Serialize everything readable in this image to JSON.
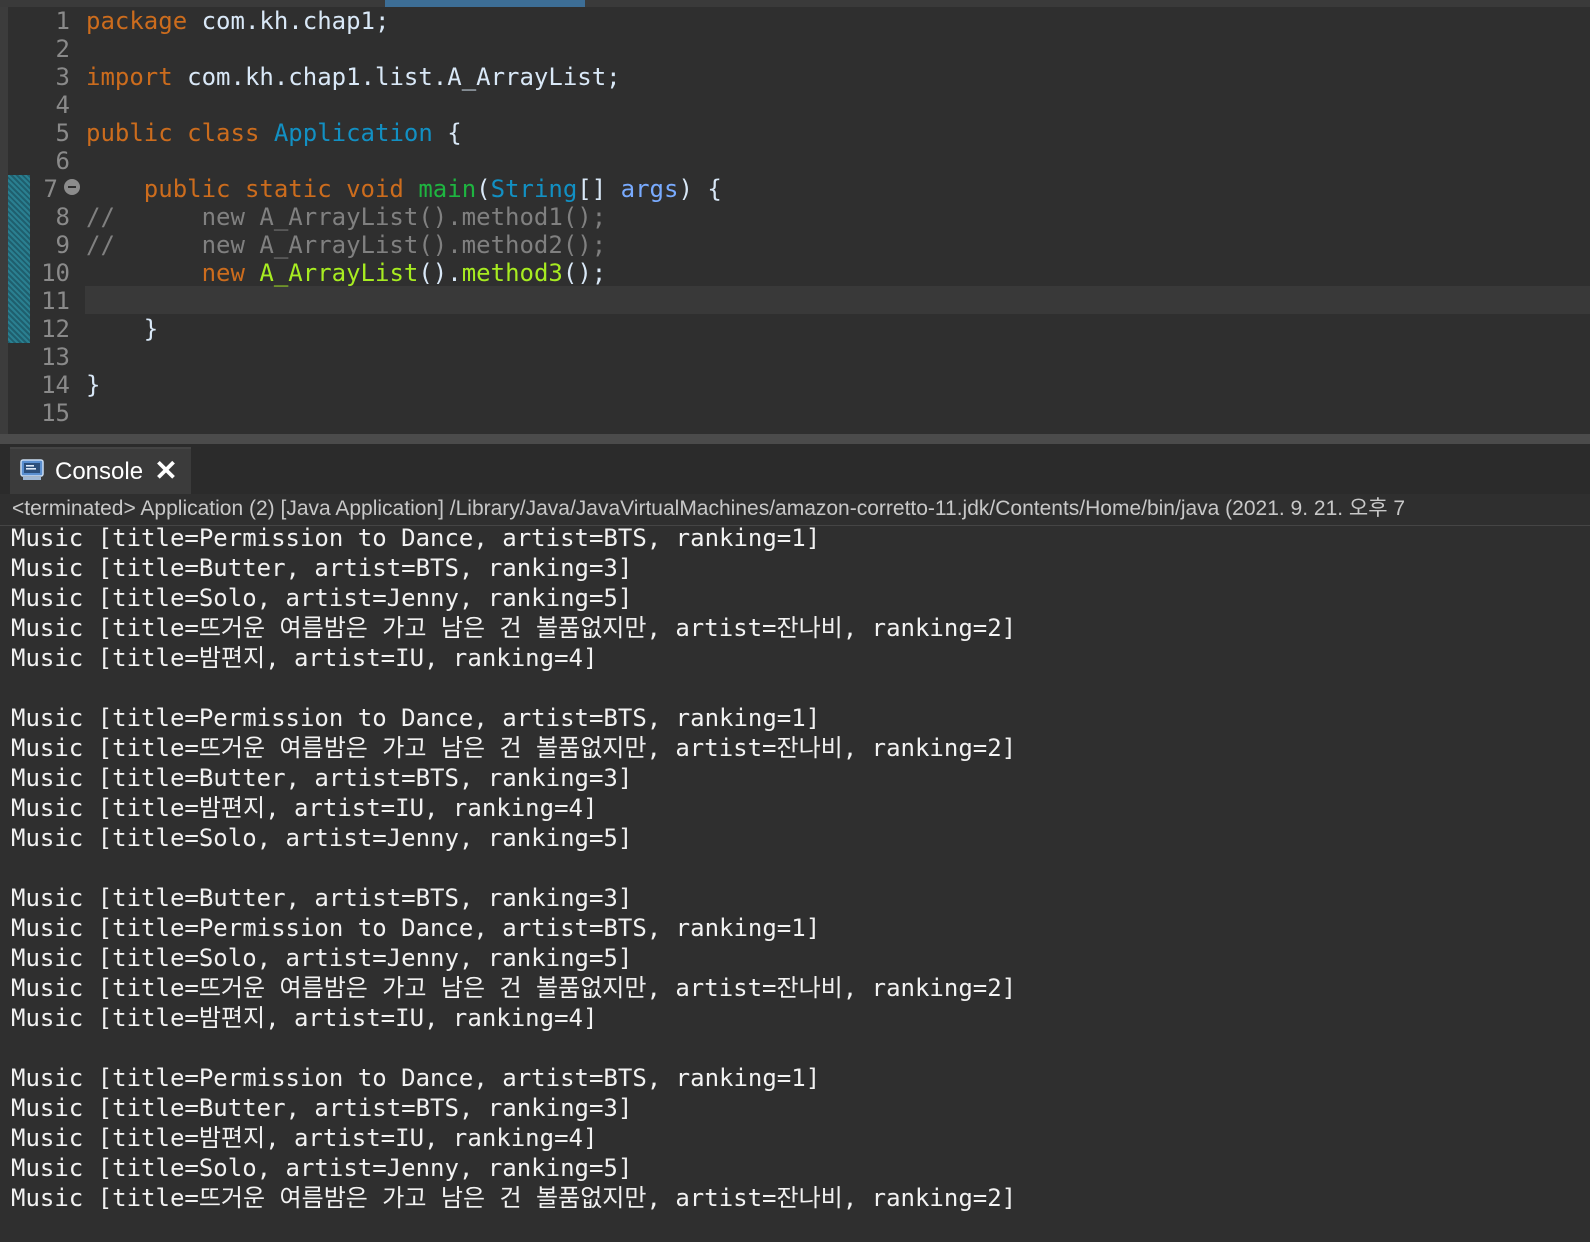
{
  "editor": {
    "line_numbers": [
      "1",
      "2",
      "3",
      "4",
      "5",
      "6",
      "7",
      "8",
      "9",
      "10",
      "11",
      "12",
      "13",
      "14",
      "15"
    ],
    "code": {
      "l1": {
        "kw": "package",
        "rest": " com.kh.chap1;"
      },
      "l3": {
        "kw": "import",
        "rest": " com.kh.chap1.list.A_ArrayList;"
      },
      "l5": {
        "kw": "public class",
        "cls": "Application",
        "rest": " {"
      },
      "l7": {
        "indent": "    ",
        "kw": "public static void",
        "fn": "main",
        "p1": "(",
        "cls": "String",
        "p2": "[] ",
        "param": "args",
        "p3": ") {"
      },
      "l8": {
        "text": "//      new A_ArrayList().method1();"
      },
      "l9": {
        "text": "//      new A_ArrayList().method2();"
      },
      "l10": {
        "indent": "        ",
        "kw": "new",
        "cls": "A_ArrayList",
        "p1": "().",
        "fn": "method3",
        "p2": "();"
      },
      "l12": {
        "text": "    }"
      },
      "l14": {
        "text": "}"
      }
    }
  },
  "console": {
    "tab_label": "Console",
    "close_symbol": "✕",
    "status": "<terminated> Application (2) [Java Application] /Library/Java/JavaVirtualMachines/amazon-corretto-11.jdk/Contents/Home/bin/java  (2021. 9. 21. 오후 7",
    "blocks": [
      [
        "Music [title=Permission to Dance, artist=BTS, ranking=1]",
        "Music [title=Butter, artist=BTS, ranking=3]",
        "Music [title=Solo, artist=Jenny, ranking=5]",
        "Music [title=뜨거운 여름밤은 가고 남은 건 볼품없지만, artist=잔나비, ranking=2]",
        "Music [title=밤편지, artist=IU, ranking=4]"
      ],
      [
        "Music [title=Permission to Dance, artist=BTS, ranking=1]",
        "Music [title=뜨거운 여름밤은 가고 남은 건 볼품없지만, artist=잔나비, ranking=2]",
        "Music [title=Butter, artist=BTS, ranking=3]",
        "Music [title=밤편지, artist=IU, ranking=4]",
        "Music [title=Solo, artist=Jenny, ranking=5]"
      ],
      [
        "Music [title=Butter, artist=BTS, ranking=3]",
        "Music [title=Permission to Dance, artist=BTS, ranking=1]",
        "Music [title=Solo, artist=Jenny, ranking=5]",
        "Music [title=뜨거운 여름밤은 가고 남은 건 볼품없지만, artist=잔나비, ranking=2]",
        "Music [title=밤편지, artist=IU, ranking=4]"
      ],
      [
        "Music [title=Permission to Dance, artist=BTS, ranking=1]",
        "Music [title=Butter, artist=BTS, ranking=3]",
        "Music [title=밤편지, artist=IU, ranking=4]",
        "Music [title=Solo, artist=Jenny, ranking=5]",
        "Music [title=뜨거운 여름밤은 가고 남은 건 볼품없지만, artist=잔나비, ranking=2]"
      ]
    ]
  }
}
